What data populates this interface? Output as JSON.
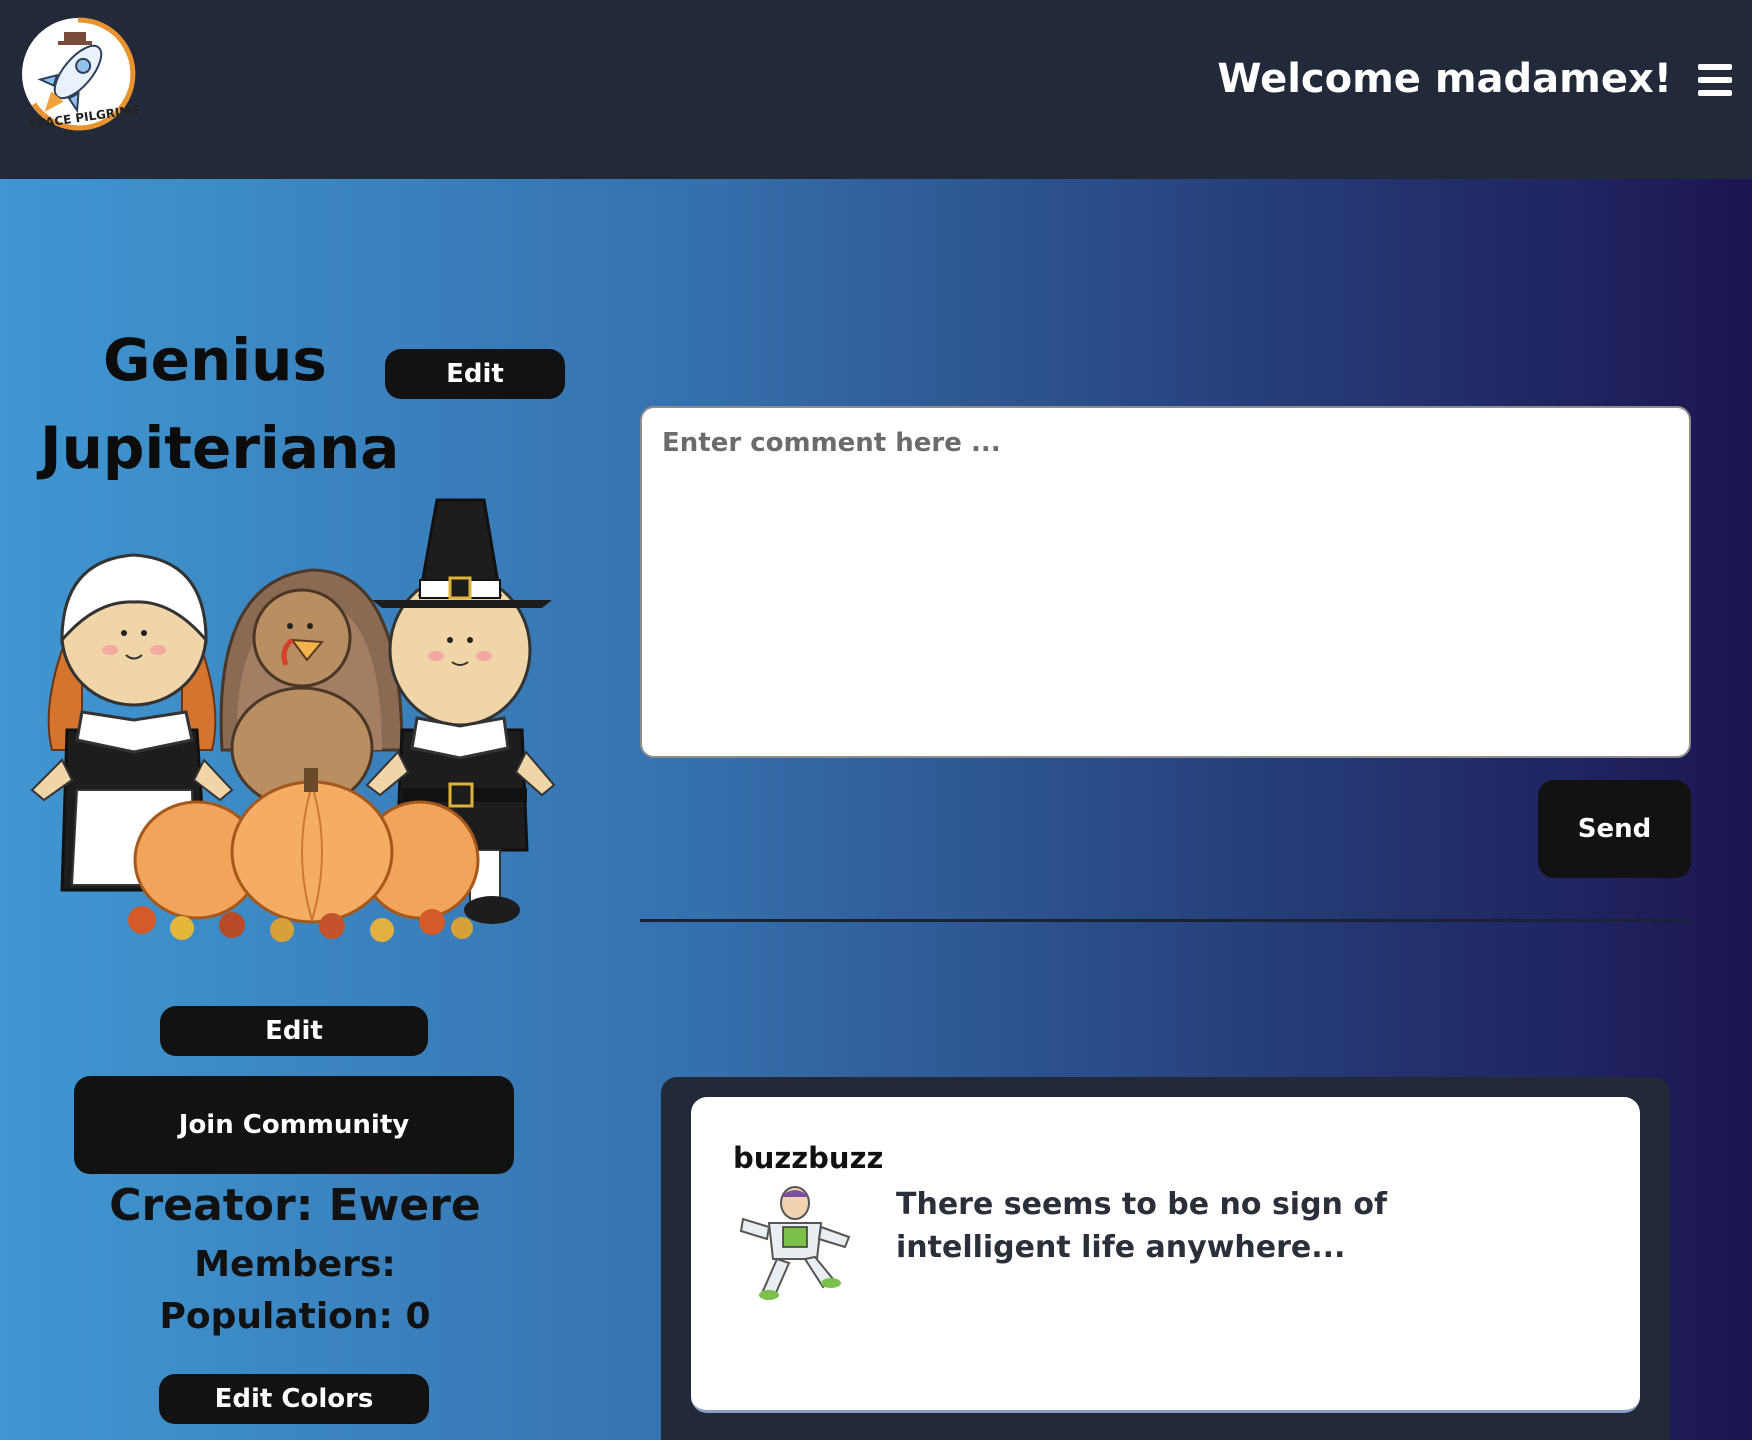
{
  "header": {
    "logo_text": "SPACE PILGRIMS",
    "welcome": "Welcome madamex!",
    "menu_icon": "hamburger-icon"
  },
  "community": {
    "title_line1": "Genius",
    "title_line2": "Jupiteriana",
    "edit_title_label": "Edit",
    "image": "pilgrims-turkey-pumpkins-illustration",
    "edit_image_label": "Edit",
    "join_label": "Join Community",
    "creator": "Creator: Ewere",
    "members": "Members:",
    "population": "Population: 0",
    "edit_colors_label": "Edit Colors"
  },
  "comment": {
    "placeholder": "Enter comment here ...",
    "send_label": "Send"
  },
  "posts": [
    {
      "user": "buzzbuzz",
      "avatar": "space-ranger-toy-avatar",
      "text": "There seems to be no sign of intelligent life anywhere..."
    }
  ],
  "colors": {
    "header_bg": "#222a39",
    "gradient_start": "#4097d2",
    "gradient_end": "#1c1552",
    "button_bg": "#121212"
  }
}
